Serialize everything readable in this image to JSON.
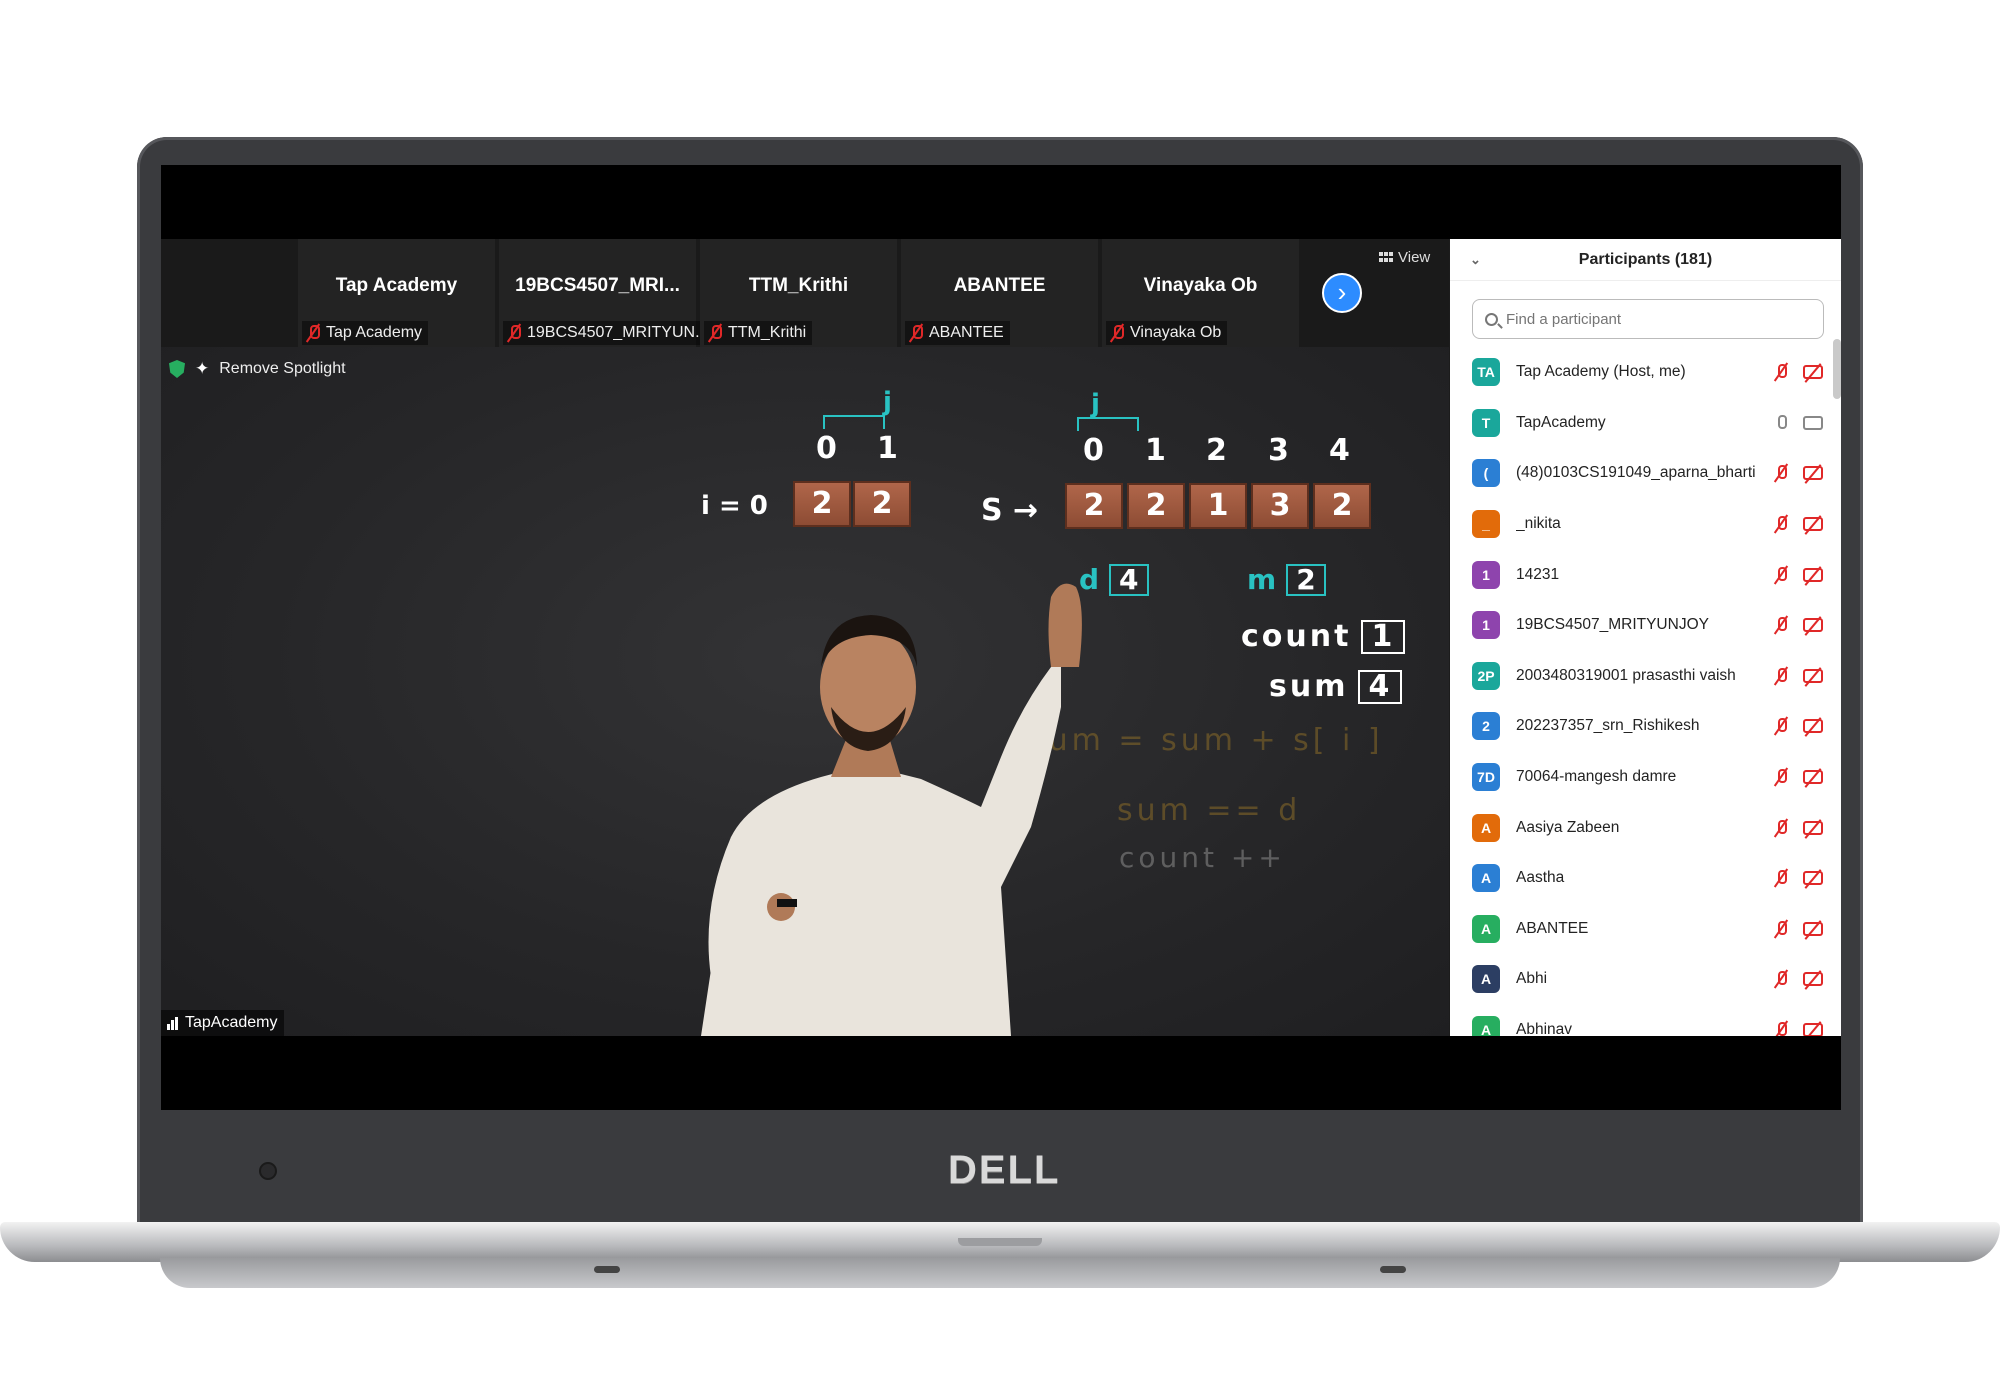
{
  "brand": {
    "laptop_logo": "DELL"
  },
  "thumbnails": [
    {
      "name": "Tap Academy",
      "tag": "Tap Academy"
    },
    {
      "name": "19BCS4507_MRI...",
      "tag": "19BCS4507_MRITYUN..."
    },
    {
      "name": "TTM_Krithi",
      "tag": "TTM_Krithi"
    },
    {
      "name": "ABANTEE",
      "tag": "ABANTEE"
    },
    {
      "name": "Vinayaka Ob",
      "tag": "Vinayaka Ob"
    }
  ],
  "toolbar": {
    "view_label": "View",
    "next_glyph": "›"
  },
  "video": {
    "remove_spotlight": "Remove Spotlight",
    "speaker": "TapAcademy",
    "lesson": {
      "j1": "j",
      "j2": "j",
      "left_idx": [
        "0",
        "1"
      ],
      "i_label": "i = 0",
      "left_cells": [
        "2",
        "2"
      ],
      "right_idx": [
        "0",
        "1",
        "2",
        "3",
        "4"
      ],
      "s_label": "S →",
      "right_cells": [
        "2",
        "2",
        "1",
        "3",
        "2"
      ],
      "d_label": "d",
      "d_val": "4",
      "m_label": "m",
      "m_val": "2",
      "count_label": "count",
      "count_val": "1",
      "sum_label": "sum",
      "sum_val": "4",
      "faint1": "sum = sum + s[ i ]",
      "faint2": "sum == d",
      "faint3": "count ++"
    }
  },
  "participants": {
    "title": "Participants (181)",
    "search_placeholder": "Find a participant",
    "list": [
      {
        "initials": "TA",
        "name": "Tap Academy (Host, me)",
        "color": "#1aa79b",
        "mic": "off",
        "cam": "off"
      },
      {
        "initials": "T",
        "name": "TapAcademy",
        "color": "#1aa79b",
        "mic": "on",
        "cam": "on"
      },
      {
        "initials": "(",
        "name": "(48)0103CS191049_aparna_bharti",
        "color": "#2b7fd4",
        "mic": "off",
        "cam": "off"
      },
      {
        "initials": "_",
        "name": "_nikita",
        "color": "#e26b0a",
        "mic": "off",
        "cam": "off"
      },
      {
        "initials": "1",
        "name": "14231",
        "color": "#8e44ad",
        "mic": "off",
        "cam": "off"
      },
      {
        "initials": "1",
        "name": "19BCS4507_MRITYUNJOY",
        "color": "#8e44ad",
        "mic": "off",
        "cam": "off"
      },
      {
        "initials": "2P",
        "name": "2003480319001 prasasthi vaish",
        "color": "#1aa79b",
        "mic": "off",
        "cam": "off"
      },
      {
        "initials": "2",
        "name": "202237357_srn_Rishikesh",
        "color": "#2b7fd4",
        "mic": "off",
        "cam": "off"
      },
      {
        "initials": "7D",
        "name": "70064-mangesh damre",
        "color": "#2b7fd4",
        "mic": "off",
        "cam": "off"
      },
      {
        "initials": "A",
        "name": "Aasiya Zabeen",
        "color": "#e26b0a",
        "mic": "off",
        "cam": "off"
      },
      {
        "initials": "A",
        "name": "Aastha",
        "color": "#2b7fd4",
        "mic": "off",
        "cam": "off"
      },
      {
        "initials": "A",
        "name": "ABANTEE",
        "color": "#27ae60",
        "mic": "off",
        "cam": "off"
      },
      {
        "initials": "A",
        "name": "Abhi",
        "color": "#2c3e63",
        "mic": "off",
        "cam": "off"
      },
      {
        "initials": "A",
        "name": "Abhinav",
        "color": "#27ae60",
        "mic": "off",
        "cam": "off"
      }
    ]
  }
}
